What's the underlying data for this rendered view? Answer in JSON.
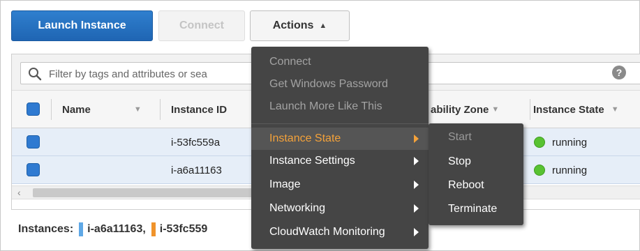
{
  "toolbar": {
    "launch_label": "Launch Instance",
    "connect_label": "Connect",
    "actions_label": "Actions"
  },
  "filter": {
    "placeholder": "Filter by tags and attributes or sea",
    "help_glyph": "?"
  },
  "table": {
    "columns": [
      {
        "label": "Name"
      },
      {
        "label": "Instance ID"
      },
      {
        "label": "ability Zone"
      },
      {
        "label": "Instance State"
      }
    ],
    "rows": [
      {
        "name": "",
        "instance_id": "i-53fc559a",
        "state": "running"
      },
      {
        "name": "",
        "instance_id": "i-a6a11163",
        "state": "running"
      }
    ]
  },
  "summary": {
    "label": "Instances:",
    "instances": [
      {
        "id": "i-a6a11163,",
        "color": "#5fa8e6"
      },
      {
        "id": "i-53fc559",
        "color": "#f0932b"
      }
    ]
  },
  "actions_menu": {
    "items": [
      {
        "label": "Connect",
        "disabled": true
      },
      {
        "label": "Get Windows Password",
        "disabled": true
      },
      {
        "label": "Launch More Like This",
        "disabled": true
      },
      {
        "label": "Instance State",
        "submenu": true,
        "active": true
      },
      {
        "label": "Instance Settings",
        "submenu": true
      },
      {
        "label": "Image",
        "submenu": true
      },
      {
        "label": "Networking",
        "submenu": true
      },
      {
        "label": "CloudWatch Monitoring",
        "submenu": true
      }
    ]
  },
  "state_submenu": {
    "items": [
      {
        "label": "Start",
        "disabled": true
      },
      {
        "label": "Stop"
      },
      {
        "label": "Reboot"
      },
      {
        "label": "Terminate"
      }
    ]
  },
  "colors": {
    "primary": "#1f65b3",
    "running": "#58c232",
    "menu_bg": "#454545",
    "menu_active_text": "#f4a23a"
  },
  "icons": {
    "search": "search-icon",
    "help": "help-icon",
    "sort": "sort-caret-icon",
    "submenu": "submenu-arrow-icon",
    "status": "status-dot-icon"
  }
}
